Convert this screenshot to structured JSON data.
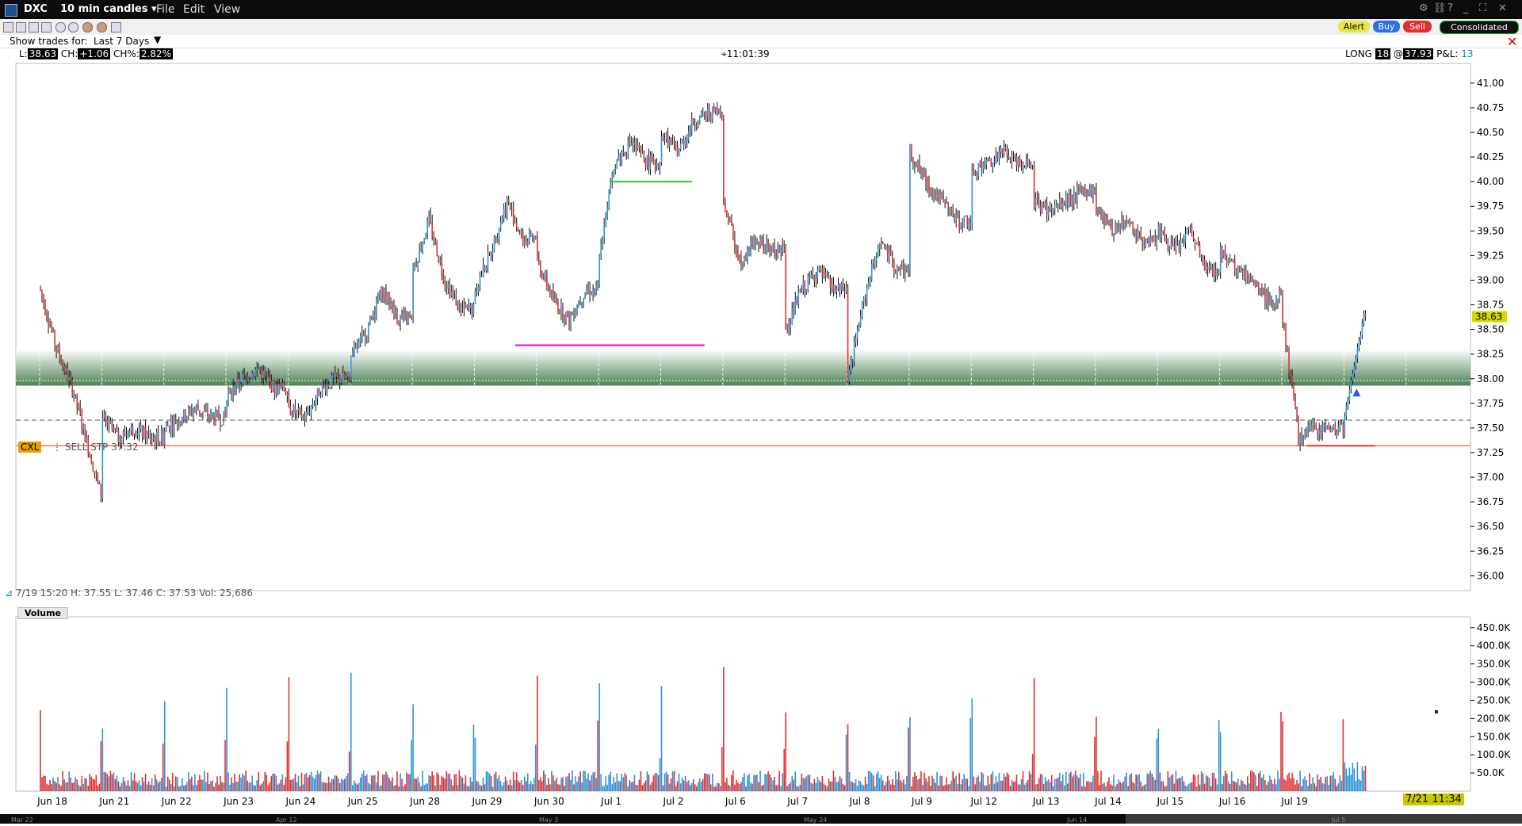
{
  "window": {
    "symbol": "DXC",
    "interval": "10 min candles ▾",
    "menu": [
      "File",
      "Edit",
      "View"
    ]
  },
  "toolbar": {
    "alert": "Alert",
    "buy": "Buy",
    "sell": "Sell",
    "consolidated": "Consolidated"
  },
  "trades": {
    "label": "Show trades for:",
    "selected": "Last 7 Days",
    "arrow": "▼"
  },
  "quote": {
    "last_label": "L:",
    "last": "38.63",
    "change_label": "CH:",
    "change": "+1.06",
    "change_pct_label": "CH%:",
    "change_pct": "2.82%",
    "time": "11:01:39",
    "position_side": "LONG",
    "position_qty": "18",
    "at": "@",
    "avg_price": "37.93",
    "pnl_label": "P&L:",
    "pnl": "13"
  },
  "order": {
    "cancel": "CXL",
    "label": "SELL STP 37.32"
  },
  "crosshair_readout": "7/19 15:20   H: 37.55   L: 37.46   C: 37.53   Vol: 25,686",
  "volume_panel": {
    "label": "Volume"
  },
  "price_badge": "38.63",
  "time_badge": "7/21 11:34",
  "chart_data": {
    "type": "candlestick",
    "price_ylim": [
      35.85,
      41.2
    ],
    "price_ticks": [
      "41.00",
      "40.75",
      "40.50",
      "40.25",
      "40.00",
      "39.75",
      "39.50",
      "39.25",
      "39.00",
      "38.75",
      "38.50",
      "38.25",
      "38.00",
      "37.75",
      "37.50",
      "37.25",
      "37.00",
      "36.75",
      "36.50",
      "36.25",
      "36.00"
    ],
    "volume_ticks": [
      "450.0K",
      "400.0K",
      "350.0K",
      "300.0K",
      "250.0K",
      "200.0K",
      "150.0K",
      "100.0K",
      "50.0K"
    ],
    "volume_ylim": [
      0,
      480000
    ],
    "x_labels": [
      "Jun 18",
      "Jun 21",
      "Jun 22",
      "Jun 23",
      "Jun 24",
      "Jun 25",
      "Jun 28",
      "Jun 29",
      "Jun 30",
      "Jul 1",
      "Jul 2",
      "Jul 6",
      "Jul 7",
      "Jul 8",
      "Jul 9",
      "Jul 12",
      "Jul 13",
      "Jul 14",
      "Jul 15",
      "Jul 16",
      "Jul 19"
    ],
    "overview_labels": [
      "Mar 22",
      "Apr 12",
      "May 3",
      "May 24",
      "Jun 14",
      "Jul 5"
    ],
    "day_closes": [
      [
        38.9,
        38.3,
        37.9,
        37.3,
        36.7,
        36.2
      ],
      [
        37.6,
        37.4,
        37.5,
        37.4
      ],
      [
        37.5,
        37.6,
        37.7,
        37.6
      ],
      [
        37.8,
        38.0,
        38.1,
        37.9
      ],
      [
        37.7,
        37.6,
        37.9,
        38.0
      ],
      [
        38.2,
        38.5,
        38.9,
        38.6
      ],
      [
        39.1,
        39.6,
        39.0,
        38.7
      ],
      [
        38.9,
        39.3,
        39.8,
        39.4
      ],
      [
        39.2,
        38.8,
        38.6,
        38.9
      ],
      [
        39.3,
        40.2,
        40.4,
        40.2
      ],
      [
        40.5,
        40.3,
        40.6,
        40.7
      ],
      [
        39.8,
        39.2,
        39.4,
        39.3
      ],
      [
        38.5,
        38.9,
        39.1,
        38.9
      ],
      [
        38.0,
        38.8,
        39.4,
        39.1
      ],
      [
        40.3,
        40.0,
        39.8,
        39.6
      ],
      [
        40.1,
        40.2,
        40.3,
        40.2
      ],
      [
        39.8,
        39.7,
        39.8,
        39.9
      ],
      [
        39.7,
        39.5,
        39.6,
        39.4
      ],
      [
        39.5,
        39.3,
        39.5,
        39.1
      ],
      [
        39.3,
        39.1,
        39.0,
        38.8
      ],
      [
        38.6,
        37.4,
        37.5,
        37.5
      ]
    ],
    "last_segment": [
      37.6,
      38.0,
      38.3,
      38.63
    ],
    "hlines": [
      {
        "value": 40.0,
        "color": "#22cc22",
        "from": 9.0,
        "to": 10.3
      },
      {
        "value": 38.34,
        "color": "#ee00cc",
        "from": 7.45,
        "to": 10.5
      },
      {
        "value": 37.58,
        "color": "#555555",
        "dash": true
      },
      {
        "value": 37.32,
        "color": "#e53030"
      }
    ],
    "support_band": [
      37.93,
      38.3
    ]
  }
}
